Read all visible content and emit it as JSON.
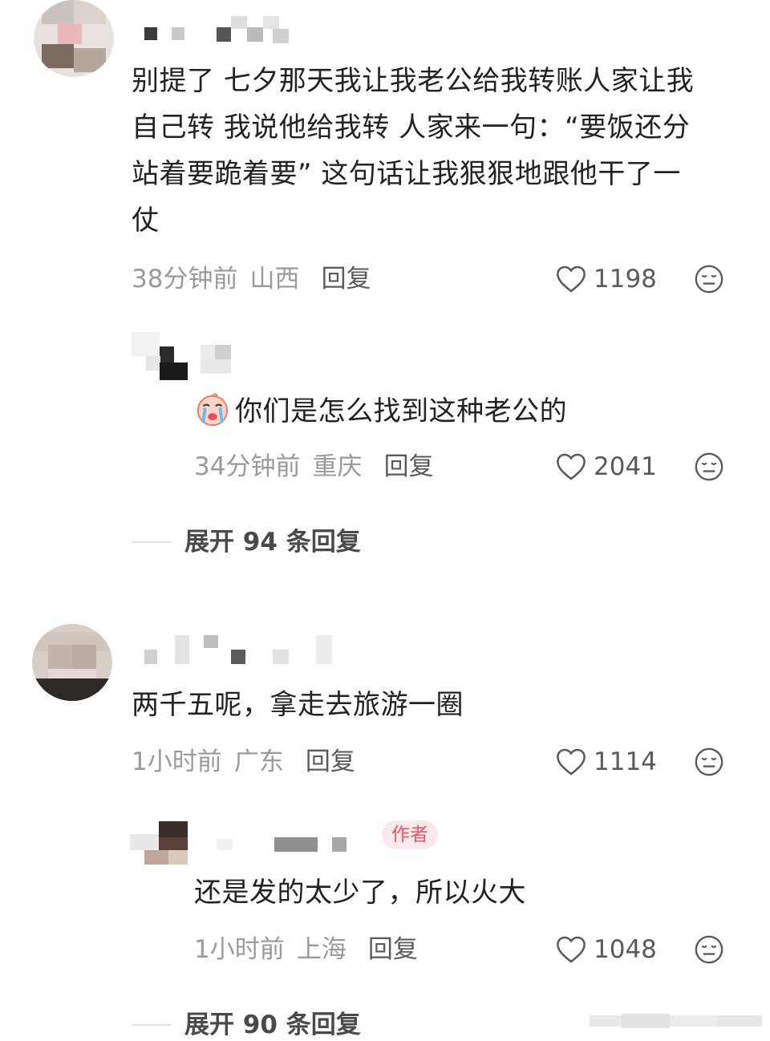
{
  "comments": [
    {
      "text_lines": [
        "别提了 七夕那天我让我老公给我转账人家让我",
        "自己转 我说他给我转 人家来一句：“要饭还分",
        "站着要跪着要” 这句话让我狠狠地跟他干了一",
        "仗"
      ],
      "time": "38分钟前",
      "location": "山西",
      "reply_label": "回复",
      "likes": "1198",
      "reply": {
        "text": "你们是怎么找到这种老公的",
        "time": "34分钟前",
        "location": "重庆",
        "reply_label": "回复",
        "likes": "2041"
      },
      "expand_label": "展开 94 条回复"
    },
    {
      "text_lines": [
        "两千五呢，拿走去旅游一圈"
      ],
      "time": "1小时前",
      "location": "广东",
      "reply_label": "回复",
      "likes": "1114",
      "reply": {
        "author_tag": "作者",
        "text": "还是发的太少了，所以火大",
        "time": "1小时前",
        "location": "上海",
        "reply_label": "回复",
        "likes": "1048"
      },
      "expand_label": "展开 90 条回复"
    }
  ],
  "icons": {
    "like": "heart-outline-icon",
    "dislike": "meh-face-icon",
    "emoji": "crying-face-emoji"
  },
  "colors": {
    "author_tag_bg": "#fde9ec",
    "author_tag_text": "#e8546a",
    "meta_gray": "#9a9a9a"
  }
}
